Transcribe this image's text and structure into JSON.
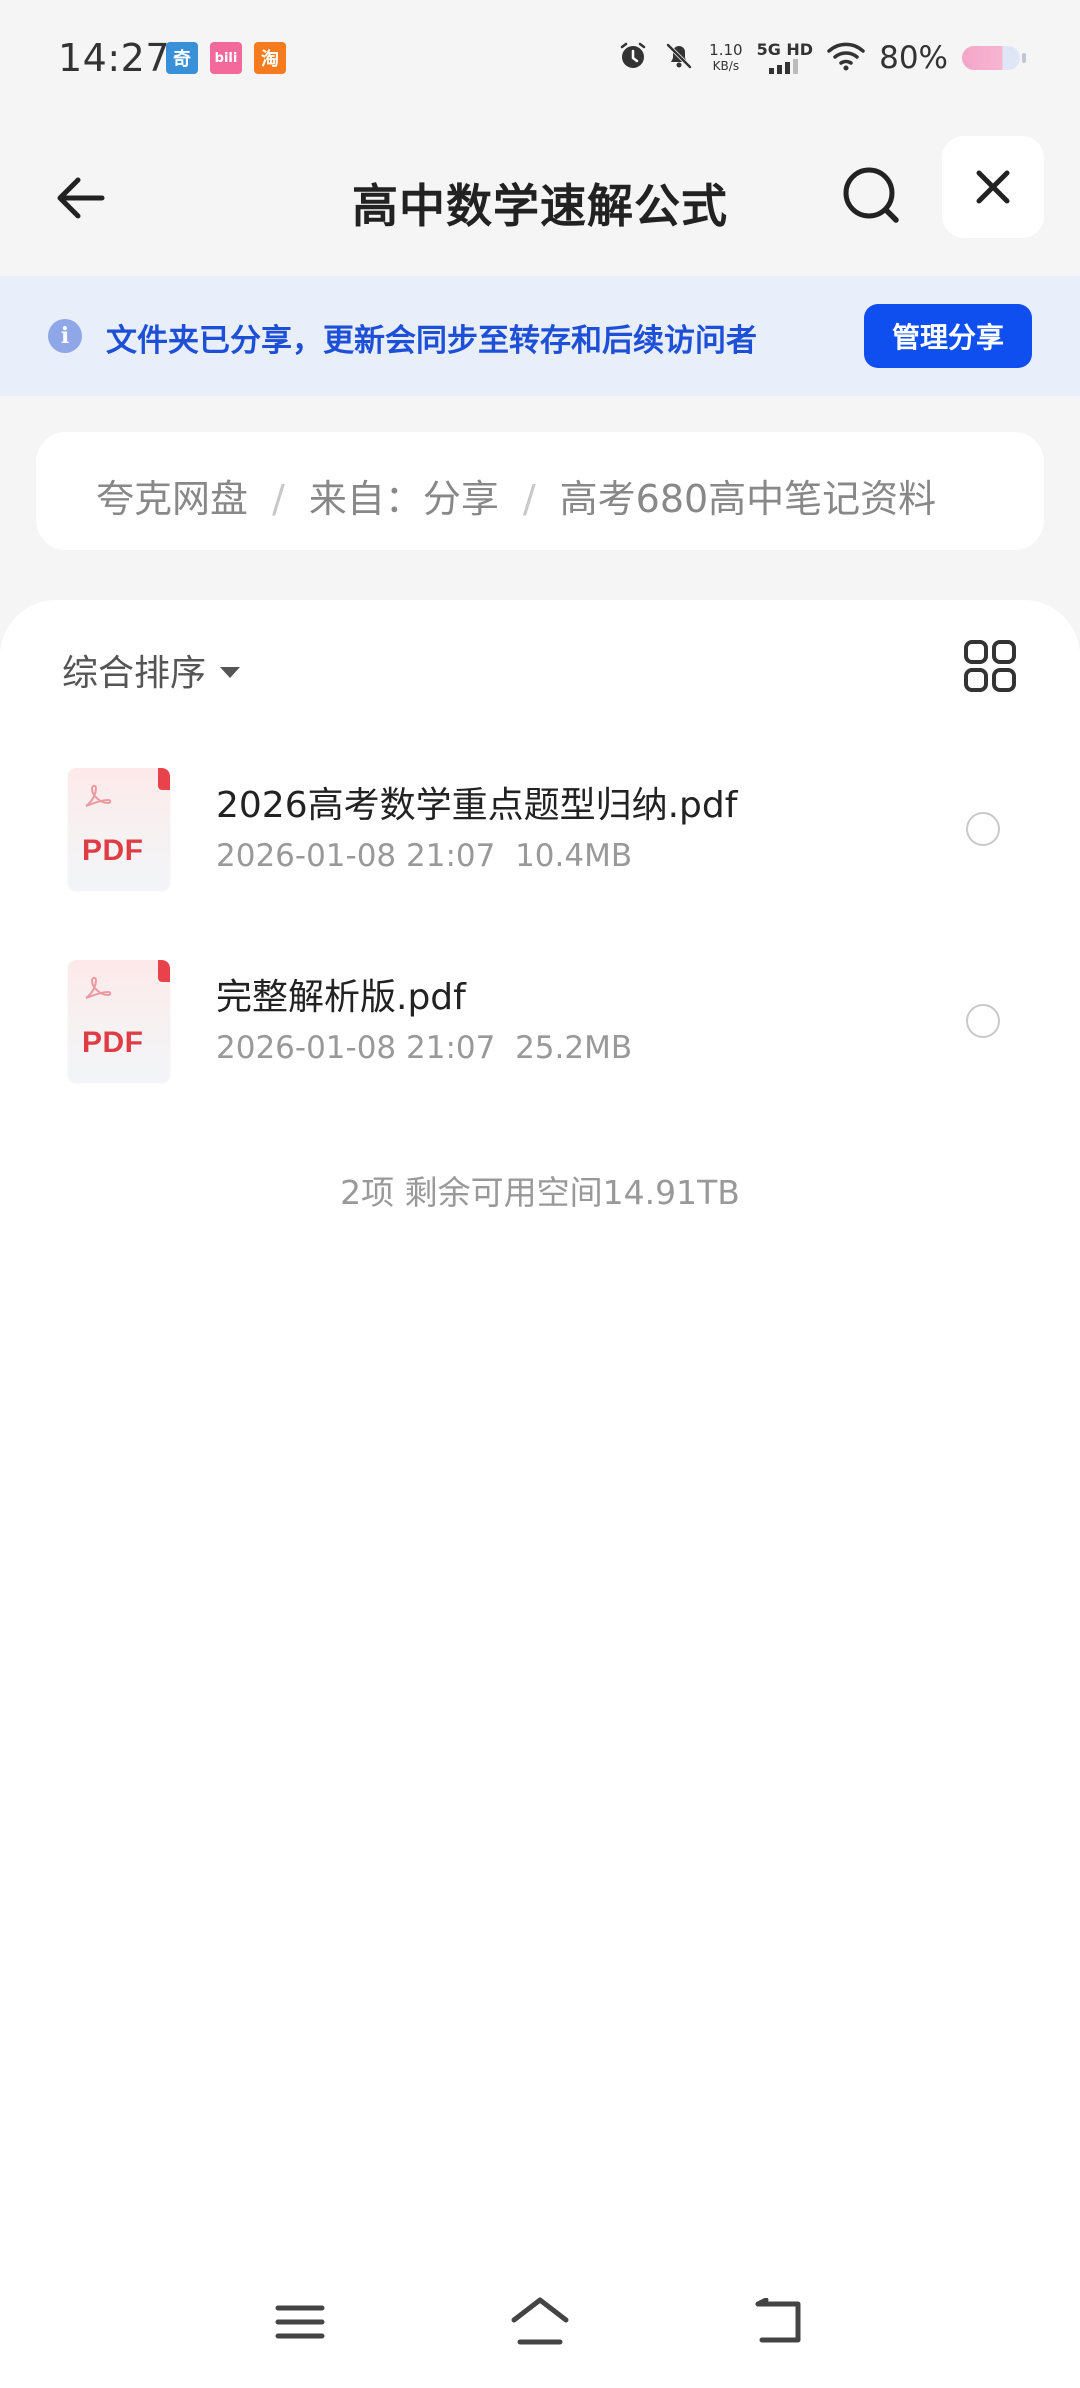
{
  "status_bar": {
    "time": "14:27",
    "apps": [
      {
        "icon": "iqiyi-app-icon",
        "glyph": "奇",
        "color": "#3a8fd9"
      },
      {
        "icon": "bilibili-app-icon",
        "glyph": "bili",
        "color": "#f36a9a"
      },
      {
        "icon": "taobao-app-icon",
        "glyph": "淘",
        "color": "#f67b1e"
      }
    ],
    "net_speed_value": "1.10",
    "net_speed_unit": "KB/s",
    "network_type": "5G HD",
    "battery": "80%",
    "battery_level": 0.8
  },
  "header": {
    "title": "高中数学速解公式"
  },
  "share_banner": {
    "text": "文件夹已分享，更新会同步至转存和后续访问者",
    "button": "管理分享"
  },
  "breadcrumb": {
    "items": [
      "夸克网盘",
      "来自：分享",
      "高考680高中笔记资料"
    ]
  },
  "toolbar": {
    "sort_label": "综合排序"
  },
  "files": [
    {
      "name": "2026高考数学重点题型归纳.pdf",
      "date": "2026-01-08 21:07",
      "size": "10.4MB",
      "type_label": "PDF"
    },
    {
      "name": "完整解析版.pdf",
      "date": "2026-01-08 21:07",
      "size": "25.2MB",
      "type_label": "PDF"
    }
  ],
  "summary": "2项 剩余可用空间14.91TB",
  "colors": {
    "accent": "#0f4ff0",
    "banner_bg": "#e9eefb",
    "banner_text": "#1d4fd7",
    "pdf_red": "#e03c45"
  }
}
